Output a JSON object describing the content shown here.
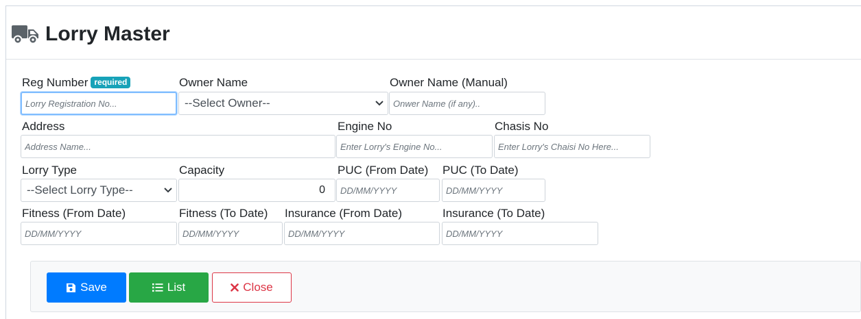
{
  "page": {
    "title": "Lorry Master",
    "title_icon": "truck-icon"
  },
  "form": {
    "reg_number": {
      "label": "Reg Number",
      "badge": "required",
      "placeholder": "Lorry Registration No..."
    },
    "owner_name": {
      "label": "Owner Name",
      "selected": "--Select Owner--"
    },
    "owner_name_manual": {
      "label": "Owner Name (Manual)",
      "placeholder": "Onwer Name (if any).."
    },
    "address": {
      "label": "Address",
      "placeholder": "Address Name..."
    },
    "engine_no": {
      "label": "Engine No",
      "placeholder": "Enter Lorry's Engine No..."
    },
    "chasis_no": {
      "label": "Chasis No",
      "placeholder": "Enter Lorry's Chaisi No Here..."
    },
    "lorry_type": {
      "label": "Lorry Type",
      "selected": "--Select Lorry Type--"
    },
    "capacity": {
      "label": "Capacity",
      "value": "0"
    },
    "puc_from": {
      "label": "PUC (From Date)",
      "placeholder": "DD/MM/YYYY"
    },
    "puc_to": {
      "label": "PUC (To Date)",
      "placeholder": "DD/MM/YYYY"
    },
    "fitness_from": {
      "label": "Fitness (From Date)",
      "placeholder": "DD/MM/YYYY"
    },
    "fitness_to": {
      "label": "Fitness (To Date)",
      "placeholder": "DD/MM/YYYY"
    },
    "insurance_from": {
      "label": "Insurance (From Date)",
      "placeholder": "DD/MM/YYYY"
    },
    "insurance_to": {
      "label": "Insurance (To Date)",
      "placeholder": "DD/MM/YYYY"
    }
  },
  "actions": {
    "save": {
      "label": "Save",
      "icon": "floppy-disk-icon",
      "color": "#007bff"
    },
    "list": {
      "label": "List",
      "icon": "list-icon",
      "color": "#28a745"
    },
    "close": {
      "label": "Close",
      "icon": "x-icon",
      "color": "#dc3545"
    }
  },
  "colors": {
    "badge": "#17a2b8",
    "focus_border": "#80bdff",
    "footer_bg": "#f8f9fa"
  }
}
